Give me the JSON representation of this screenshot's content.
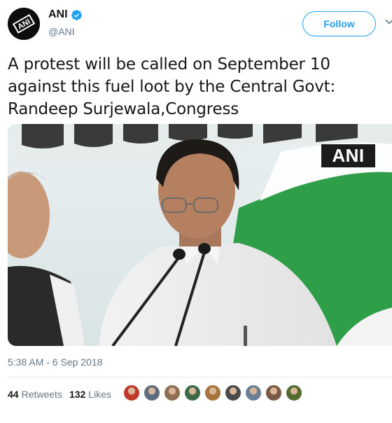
{
  "account": {
    "display_name": "ANI",
    "handle": "@ANI",
    "avatar_label": "ANI",
    "verified_icon": "verified-badge-icon"
  },
  "actions": {
    "follow_label": "Follow",
    "menu_icon": "chevron-down-icon"
  },
  "tweet": {
    "text_line_1": "A protest will be called on September 10",
    "text_line_2": "against this fuel loot by the Central Govt:",
    "text_line_3": "Randeep Surjewala,Congress",
    "media_watermark": "ANI",
    "timestamp": "5:38 AM - 6 Sep 2018"
  },
  "stats": {
    "retweets_count": "44",
    "retweets_label": "Retweets",
    "likes_count": "132",
    "likes_label": "Likes"
  },
  "likers": [
    {
      "color": "#c0392b"
    },
    {
      "color": "#5d6d7e"
    },
    {
      "color": "#8e6e53"
    },
    {
      "color": "#3d6b4a"
    },
    {
      "color": "#a9743b"
    },
    {
      "color": "#4a4a4a"
    },
    {
      "color": "#6b7f95"
    },
    {
      "color": "#7a5a44"
    },
    {
      "color": "#556b2f"
    }
  ],
  "colors": {
    "brand_blue": "#1da1f2",
    "secondary_text": "#657786",
    "congress_green": "#138a36",
    "congress_saffron": "#f7931e"
  }
}
